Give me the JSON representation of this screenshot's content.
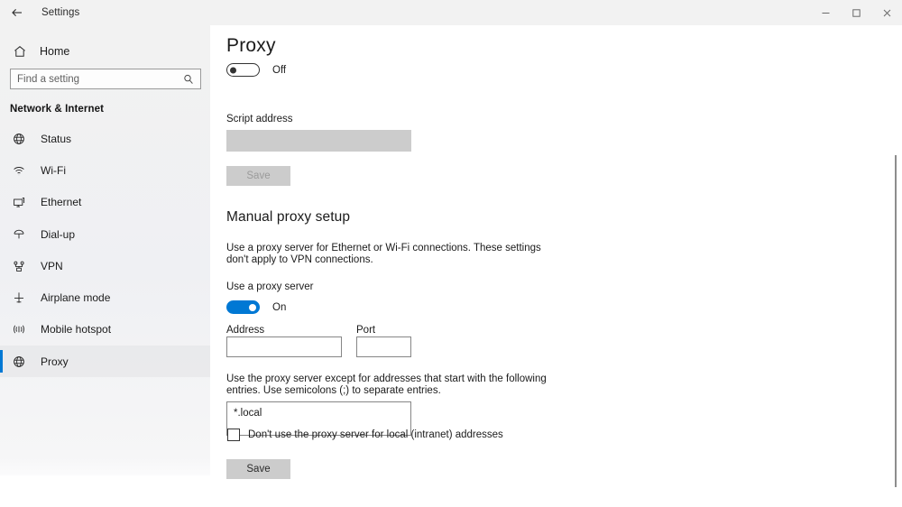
{
  "titlebar": {
    "back_icon": "back-arrow-icon",
    "title": "Settings",
    "minimize": "–",
    "maximize": "❑",
    "close": "✕"
  },
  "sidebar": {
    "home": {
      "label": "Home",
      "icon": "home-icon"
    },
    "search": {
      "placeholder": "Find a setting",
      "icon": "search-icon"
    },
    "section_title": "Network & Internet",
    "accent_color": "#0078d4",
    "items": [
      {
        "label": "Status",
        "icon": "globe-icon",
        "selected": false
      },
      {
        "label": "Wi-Fi",
        "icon": "wifi-icon",
        "selected": false
      },
      {
        "label": "Ethernet",
        "icon": "ethernet-icon",
        "selected": false
      },
      {
        "label": "Dial-up",
        "icon": "dialup-icon",
        "selected": false
      },
      {
        "label": "VPN",
        "icon": "vpn-icon",
        "selected": false
      },
      {
        "label": "Airplane mode",
        "icon": "airplane-icon",
        "selected": false
      },
      {
        "label": "Mobile hotspot",
        "icon": "hotspot-icon",
        "selected": false
      },
      {
        "label": "Proxy",
        "icon": "globe-icon",
        "selected": true
      }
    ]
  },
  "main": {
    "page_title": "Proxy",
    "auto_setup": {
      "toggle_state": "Off",
      "script_address_label": "Script address",
      "script_address_value": "",
      "save_label": "Save",
      "save_enabled": false
    },
    "manual_setup": {
      "heading": "Manual proxy setup",
      "description_line1": "Use a proxy server for Ethernet or Wi-Fi connections. These settings",
      "description_line2": "don't apply to VPN connections.",
      "use_proxy_label": "Use a proxy server",
      "use_proxy_state": "On",
      "address_label": "Address",
      "address_value": "",
      "port_label": "Port",
      "port_value": "",
      "exceptions_line1": "Use the proxy server except for addresses that start with the following",
      "exceptions_line2": "entries. Use semicolons (;) to separate entries.",
      "exceptions_value": "*.local",
      "bypass_local_label": "Don't use the proxy server for local (intranet) addresses",
      "bypass_local_checked": false,
      "save_label": "Save",
      "save_enabled": true
    }
  }
}
